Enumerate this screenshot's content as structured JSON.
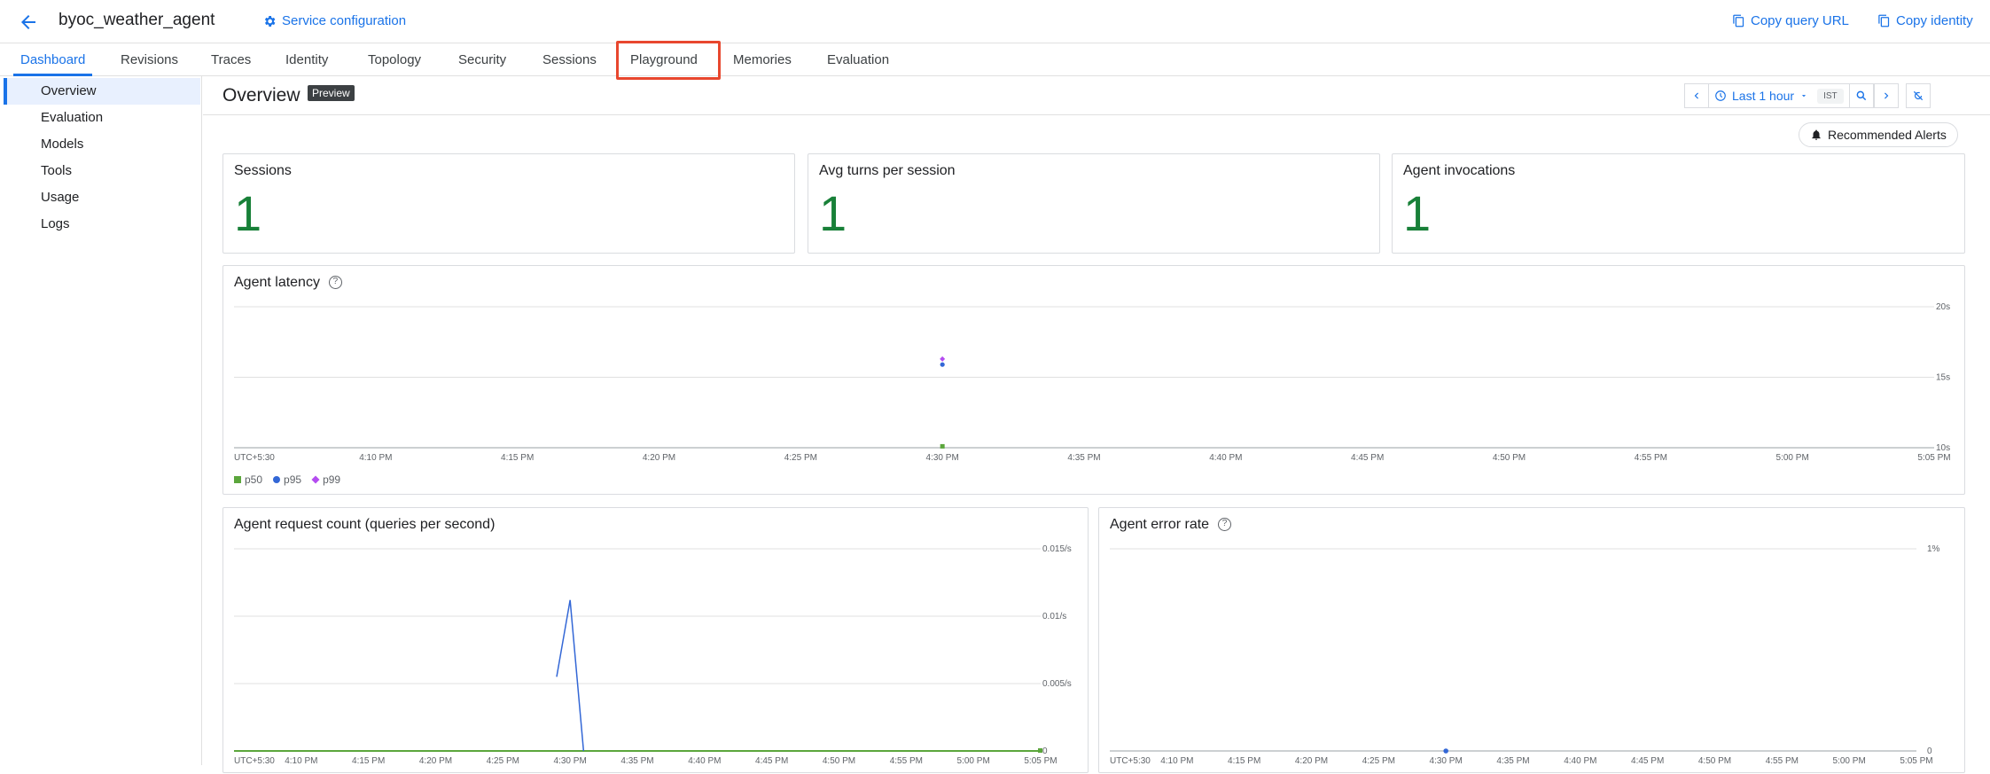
{
  "header": {
    "title": "byoc_weather_agent",
    "service_config": "Service configuration",
    "copy_query_url": "Copy query URL",
    "copy_identity": "Copy identity"
  },
  "tabs": [
    "Dashboard",
    "Revisions",
    "Traces",
    "Identity",
    "Topology",
    "Security",
    "Sessions",
    "Playground",
    "Memories",
    "Evaluation"
  ],
  "active_tab": "Dashboard",
  "highlighted_tab": "Playground",
  "sidebar": {
    "items": [
      "Overview",
      "Evaluation",
      "Models",
      "Tools",
      "Usage",
      "Logs"
    ],
    "active": "Overview"
  },
  "overview": {
    "title": "Overview",
    "badge": "Preview",
    "time_range": "Last 1 hour",
    "timezone": "IST",
    "recommended_alerts": "Recommended Alerts"
  },
  "metrics": [
    {
      "label": "Sessions",
      "value": "1"
    },
    {
      "label": "Avg turns per session",
      "value": "1"
    },
    {
      "label": "Agent invocations",
      "value": "1"
    }
  ],
  "colors": {
    "accent": "#1a73e8",
    "metric_green": "#188038",
    "highlight_red": "#e8472e",
    "p50": "#5ba63c",
    "p95": "#3367d6",
    "p99": "#b44cf0"
  },
  "chart_data": [
    {
      "type": "scatter",
      "title": "Agent latency",
      "x_ticks": [
        "UTC+5:30",
        "4:10 PM",
        "4:15 PM",
        "4:20 PM",
        "4:25 PM",
        "4:30 PM",
        "4:35 PM",
        "4:40 PM",
        "4:45 PM",
        "4:50 PM",
        "4:55 PM",
        "5:00 PM",
        "5:05 PM"
      ],
      "y_ticks": [
        "20s",
        "15s",
        "10s"
      ],
      "ylim": [
        10,
        20
      ],
      "series": [
        {
          "name": "p50",
          "points": [
            {
              "x": "4:30 PM",
              "y": 10.1
            }
          ]
        },
        {
          "name": "p95",
          "points": [
            {
              "x": "4:30 PM",
              "y": 15.9
            }
          ]
        },
        {
          "name": "p99",
          "points": [
            {
              "x": "4:30 PM",
              "y": 16.3
            }
          ]
        }
      ],
      "legend": [
        "p50",
        "p95",
        "p99"
      ]
    },
    {
      "type": "line",
      "title": "Agent request count (queries per second)",
      "x_ticks": [
        "UTC+5:30",
        "4:10 PM",
        "4:15 PM",
        "4:20 PM",
        "4:25 PM",
        "4:30 PM",
        "4:35 PM",
        "4:40 PM",
        "4:45 PM",
        "4:50 PM",
        "4:55 PM",
        "5:00 PM",
        "5:05 PM"
      ],
      "y_ticks": [
        "0.015/s",
        "0.01/s",
        "0.005/s",
        "0"
      ],
      "ylim": [
        0,
        0.015
      ],
      "series": [
        {
          "points": [
            {
              "x": "4:29 PM",
              "y": 0.0055
            },
            {
              "x": "4:30 PM",
              "y": 0.0112
            },
            {
              "x": "4:31 PM",
              "y": 0
            }
          ]
        },
        {
          "points": [
            {
              "x": "UTC+5:30",
              "y": 0
            },
            {
              "x": "5:05 PM",
              "y": 0
            }
          ]
        }
      ]
    },
    {
      "type": "line",
      "title": "Agent error rate",
      "x_ticks": [
        "UTC+5:30",
        "4:10 PM",
        "4:15 PM",
        "4:20 PM",
        "4:25 PM",
        "4:30 PM",
        "4:35 PM",
        "4:40 PM",
        "4:45 PM",
        "4:50 PM",
        "4:55 PM",
        "5:00 PM",
        "5:05 PM"
      ],
      "y_ticks": [
        "1%",
        "0"
      ],
      "ylim": [
        0,
        1
      ],
      "series": [
        {
          "points": [
            {
              "x": "4:30 PM",
              "y": 0
            }
          ]
        }
      ]
    }
  ]
}
